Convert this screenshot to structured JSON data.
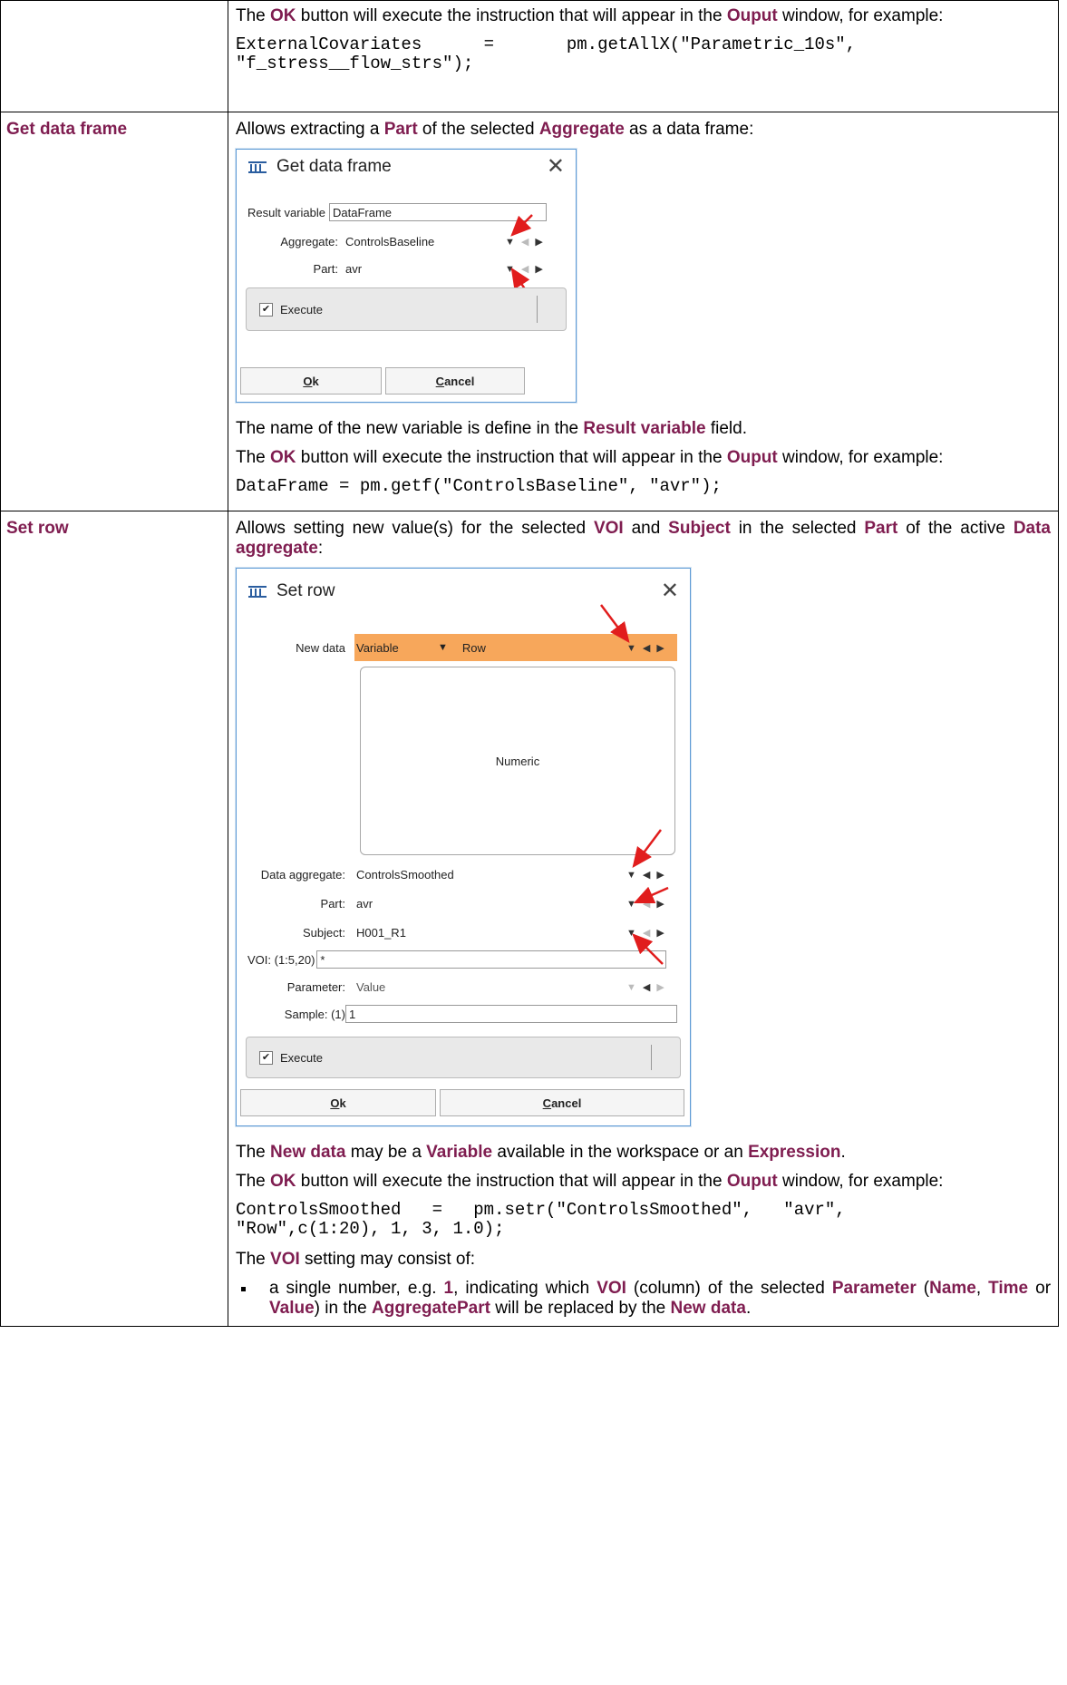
{
  "top_cell": {
    "para1": [
      "The ",
      "OK",
      " button will execute the instruction that will appear in the ",
      "Ouput",
      " window, for example:"
    ],
    "code": "ExternalCovariates      =       pm.getAllX(\"Parametric_10s\",\n\"f_stress__flow_strs\");"
  },
  "get_data_frame": {
    "term": "Get data frame",
    "intro": [
      "Allows extracting a ",
      "Part",
      " of the selected ",
      "Aggregate",
      " as a data frame:"
    ],
    "dialog": {
      "title": "Get data frame",
      "result_variable_label": "Result variable",
      "result_variable_value": "DataFrame",
      "aggregate_label": "Aggregate:",
      "aggregate_value": "ControlsBaseline",
      "part_label": "Part:",
      "part_value": "avr",
      "execute_label": "Execute",
      "ok_label": "k",
      "ok_mnemonic": "O",
      "cancel_label": "ancel",
      "cancel_mnemonic": "C"
    },
    "para_name": [
      "The name of the new variable is define in the ",
      "Result variable",
      " field."
    ],
    "para_ok": [
      "The ",
      "OK",
      " button will execute the instruction that will appear in the ",
      "Ouput",
      " window, for example:"
    ],
    "code": "DataFrame = pm.getf(\"ControlsBaseline\", \"avr\");"
  },
  "set_row": {
    "term": "Set row",
    "intro": [
      "Allows setting new value(s) for the selected ",
      "VOI",
      " and ",
      "Subject",
      " in the selected ",
      "Part",
      " of the active ",
      "Data aggregate",
      ":"
    ],
    "dialog": {
      "title": "Set row",
      "new_data_label": "New data",
      "new_data_type": "Variable",
      "new_data_value": "Row",
      "numeric_label": "Numeric",
      "data_aggregate_label": "Data aggregate:",
      "data_aggregate_value": "ControlsSmoothed",
      "part_label": "Part:",
      "part_value": "avr",
      "subject_label": "Subject:",
      "subject_value": "H001_R1",
      "voi_label": "VOI: (1:5,20)",
      "voi_value": "*",
      "parameter_label": "Parameter:",
      "parameter_value": "Value",
      "sample_label": "Sample: (1)",
      "sample_value": "1",
      "execute_label": "Execute",
      "ok_label": "k",
      "ok_mnemonic": "O",
      "cancel_label": "ancel",
      "cancel_mnemonic": "C"
    },
    "para_new_data": [
      "The ",
      "New data",
      " may be a ",
      "Variable",
      " available in the workspace or an ",
      "Expression",
      "."
    ],
    "para_ok": [
      "The ",
      "OK",
      " button will execute the instruction that will appear in the ",
      "Ouput",
      " window, for example:"
    ],
    "code": "ControlsSmoothed   =   pm.setr(\"ControlsSmoothed\",   \"avr\",\n\"Row\",c(1:20), 1, 3, 1.0);",
    "para_voi": [
      "The ",
      "VOI",
      " setting may consist of:"
    ],
    "bullet1": [
      "a single number, e.g. ",
      "1",
      ", indicating which ",
      "VOI",
      " (column) of the selected ",
      "Parameter",
      " (",
      "Name",
      ", ",
      "Time",
      " or ",
      "Value",
      ") in the ",
      "AggregatePart",
      " will be replaced by the ",
      "New data",
      "."
    ]
  }
}
